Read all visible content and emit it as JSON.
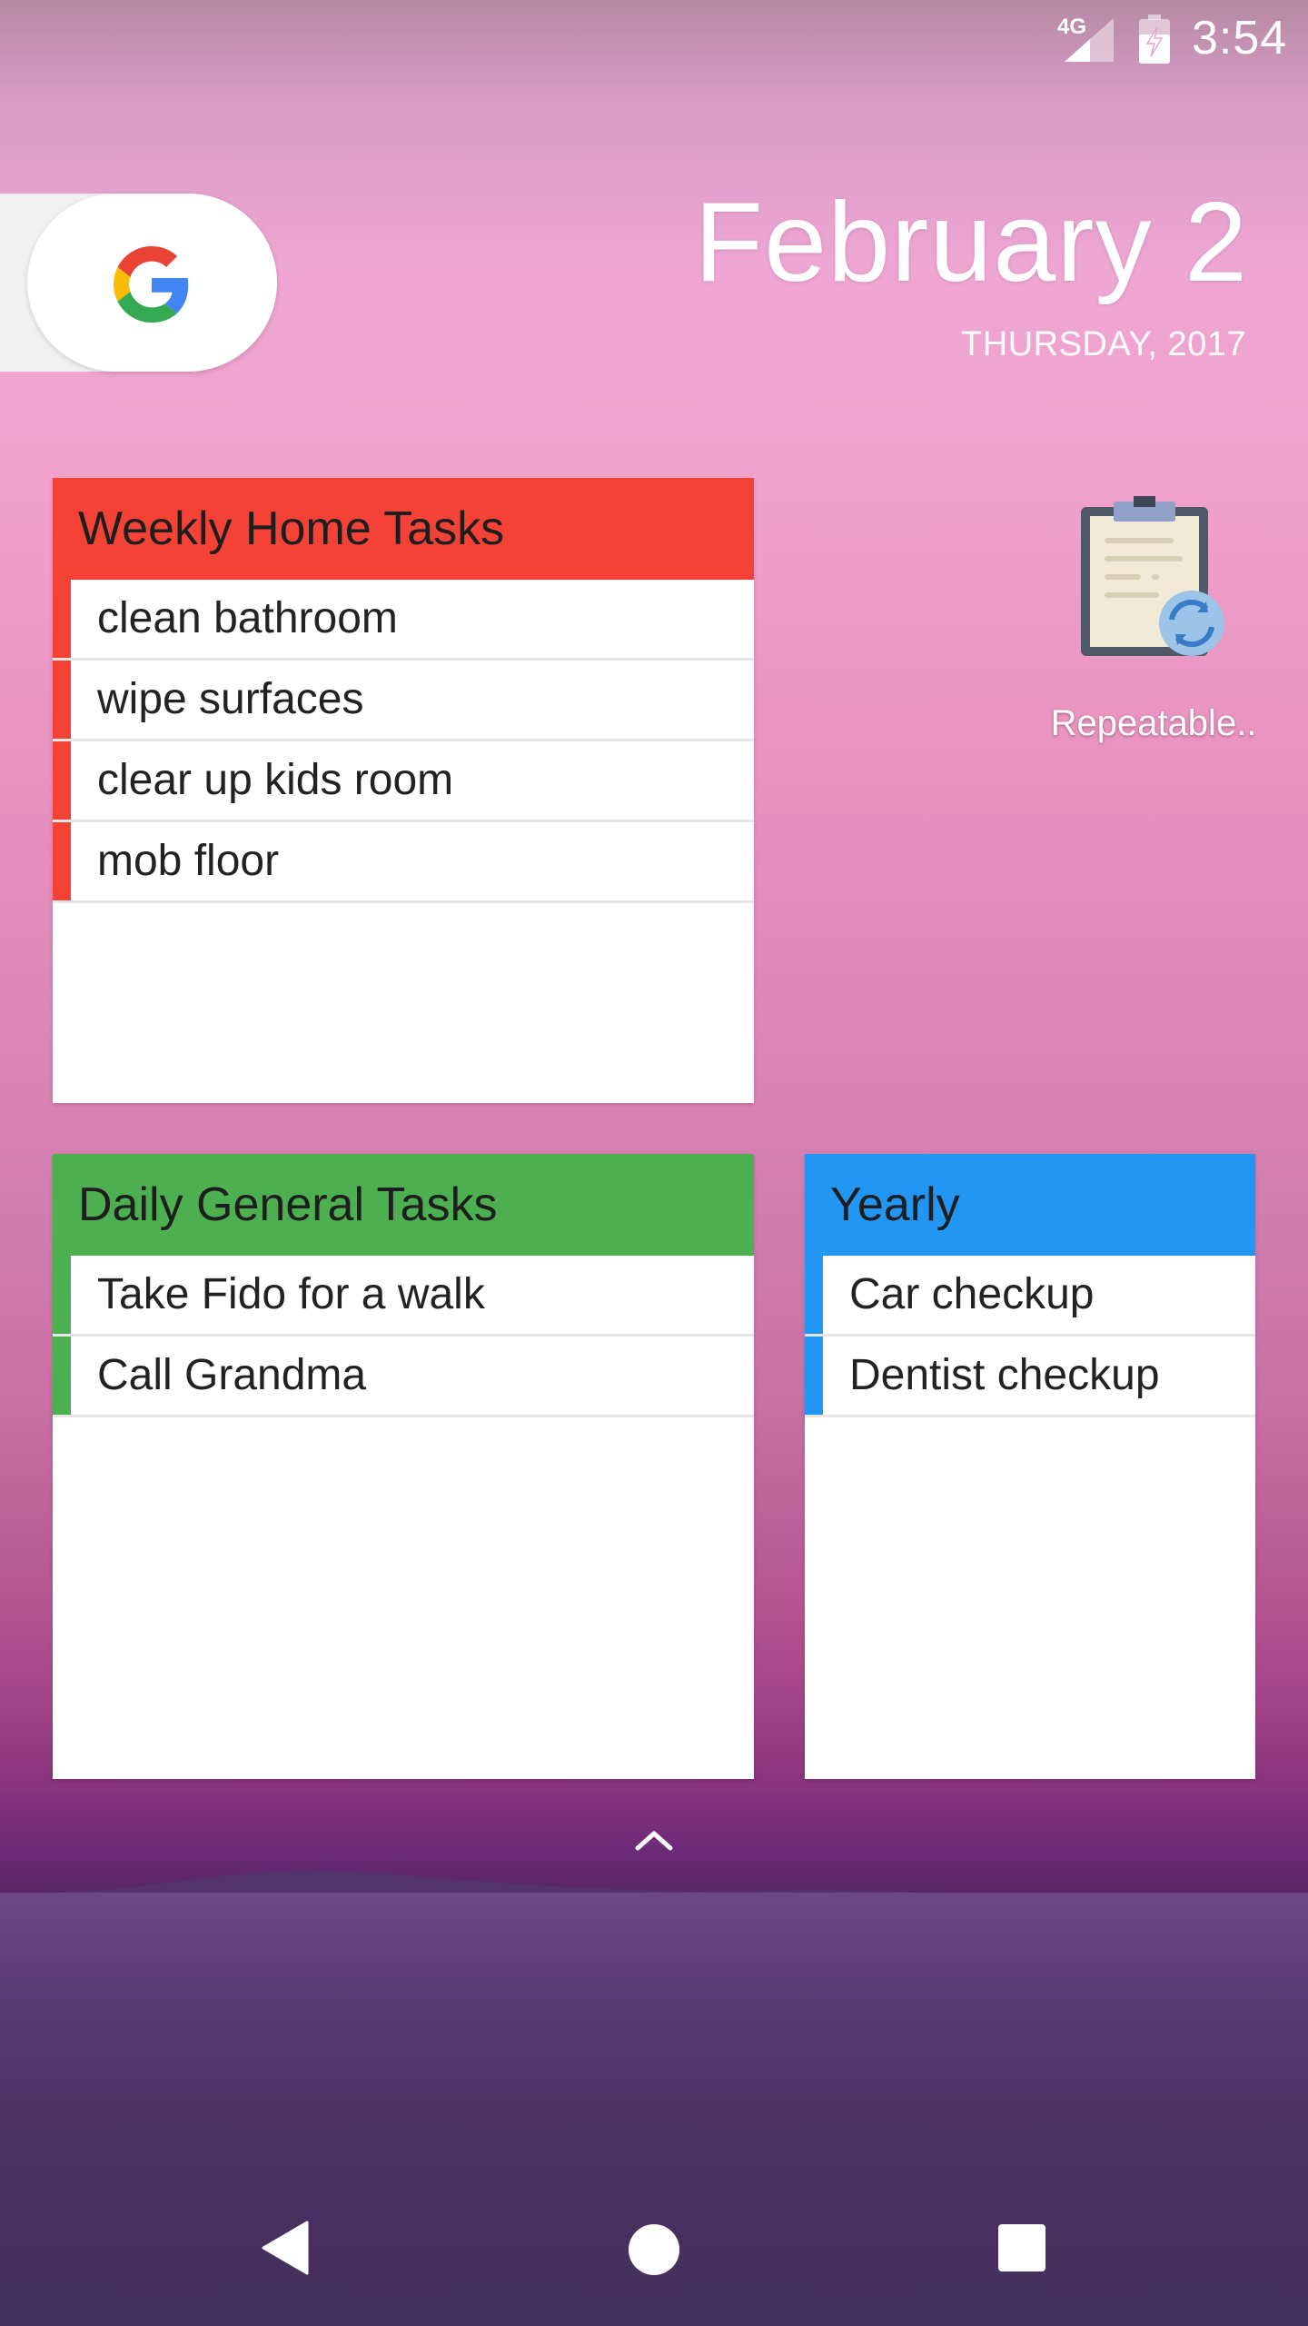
{
  "status_bar": {
    "network": "4G",
    "time": "3:54"
  },
  "date_widget": {
    "date": "February 2",
    "weekday_year": "THURSDAY, 2017"
  },
  "widgets": {
    "weekly": {
      "title": "Weekly Home Tasks",
      "color": "#f44336",
      "tasks": [
        "clean bathroom",
        "wipe surfaces",
        "clear up kids room",
        "mob floor"
      ]
    },
    "daily": {
      "title": "Daily General Tasks",
      "color": "#4caf50",
      "tasks": [
        "Take Fido for a walk",
        "Call Grandma"
      ]
    },
    "yearly": {
      "title": "Yearly",
      "color": "#2196f3",
      "tasks": [
        "Car checkup",
        "Dentist checkup"
      ]
    }
  },
  "app_shortcut": {
    "label": "Repeatable..",
    "icon": "clipboard-repeat-icon"
  },
  "navigation": {
    "back": "back-icon",
    "home": "home-icon",
    "recents": "recents-icon",
    "drawer": "chevron-up-icon"
  }
}
